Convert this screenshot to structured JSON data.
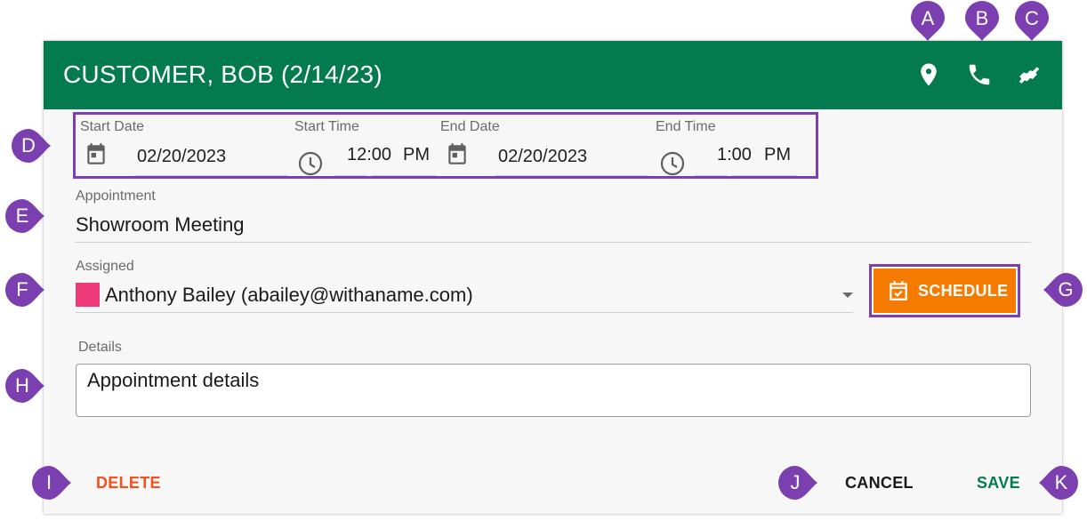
{
  "header": {
    "title": "CUSTOMER, BOB (2/14/23)",
    "bg_color": "#047b4e",
    "icons": [
      "location-pin-icon",
      "phone-icon",
      "handshake-icon"
    ]
  },
  "datetime": {
    "start_date_label": "Start Date",
    "start_date": "02/20/2023",
    "start_time_label": "Start Time",
    "start_time_value": "12:00",
    "start_time_ampm": "PM",
    "end_date_label": "End Date",
    "end_date": "02/20/2023",
    "end_time_label": "End Time",
    "end_time_value": "1:00",
    "end_time_ampm": "PM"
  },
  "appointment": {
    "label": "Appointment",
    "value": "Showroom Meeting"
  },
  "assigned": {
    "label": "Assigned",
    "value": "Anthony Bailey (abailey@withaname.com)",
    "color": "#ef3b7a"
  },
  "schedule_button": {
    "label": "SCHEDULE",
    "color": "#f47b00"
  },
  "details": {
    "label": "Details",
    "value": "Appointment details"
  },
  "actions": {
    "delete_label": "DELETE",
    "delete_color": "#f4511e",
    "cancel_label": "CANCEL",
    "save_label": "SAVE",
    "save_color": "#047b4e"
  },
  "callouts": {
    "color": "#7b3fb0",
    "letters": {
      "a": "A",
      "b": "B",
      "c": "C",
      "d": "D",
      "e": "E",
      "f": "F",
      "g": "G",
      "h": "H",
      "i": "I",
      "j": "J",
      "k": "K"
    }
  }
}
